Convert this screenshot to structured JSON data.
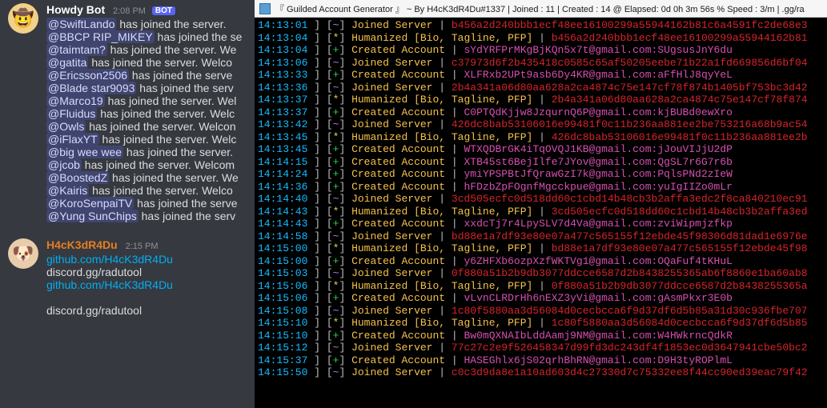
{
  "discord": {
    "bot": {
      "name": "Howdy Bot",
      "time": "2:08 PM",
      "bot_label": "BOT",
      "joins": [
        {
          "user": "SwiftLando",
          "tail": "has joined the server."
        },
        {
          "user": "BBCP RIP_MIKEY",
          "tail": "has joined the se"
        },
        {
          "user": "taimtam?",
          "tail": "has joined the server. We"
        },
        {
          "user": "gatita",
          "tail": "has joined the server. Welco"
        },
        {
          "user": "Ericsson2506",
          "tail": "has joined the serve"
        },
        {
          "user": "Blade star9093",
          "tail": "has joined the serv"
        },
        {
          "user": "Marco19",
          "tail": "has joined the server. Wel"
        },
        {
          "user": "Fluidus",
          "tail": "has joined the server. Welc"
        },
        {
          "user": "Owls",
          "tail": "has joined the server. Welcon"
        },
        {
          "user": "iFlaxYT",
          "tail": "has joined the server. Welc"
        },
        {
          "user": "big wee wee",
          "tail": "has joined the server."
        },
        {
          "user": "jcob",
          "tail": "has joined the server. Welcom"
        },
        {
          "user": "BoostedZ",
          "tail": "has joined the server. We"
        },
        {
          "user": "Kairis",
          "tail": "has joined the server. Welco"
        },
        {
          "user": "KoroSenpaiTV",
          "tail": "has joined the serve"
        },
        {
          "user": "Yung SunChips",
          "tail": "has joined the serv"
        }
      ]
    },
    "hacker": {
      "name": "H4cK3dR4Du",
      "time": "2:15 PM",
      "lines": [
        {
          "text": "github.com/H4cK3dR4Du",
          "link": true
        },
        {
          "text": "discord.gg/radutool",
          "link": false
        },
        {
          "text": "github.com/H4cK3dR4Du",
          "link": true
        },
        {
          "text": "",
          "link": false,
          "spacer": true
        },
        {
          "text": "discord.gg/radutool",
          "link": false
        }
      ]
    }
  },
  "console": {
    "title": "『 Guilded Account Generator 』 ~ By H4cK3dR4Du#1337 | Joined : 11 | Created : 14 @ Elapsed: 0d 0h 3m 56s % Speed : 3/m | .gg/ra",
    "log": [
      {
        "t": "14:13:01",
        "sym": "~",
        "lbl": "Joined Server",
        "val": "b456a2d240bbb1ecf48ee16100299a55944162b81c6a4591fc2de68e3",
        "vc": "red"
      },
      {
        "t": "14:13:04",
        "sym": "*",
        "lbl": "Humanized [Bio, Tagline, PFP]",
        "val": "b456a2d240bbb1ecf48ee16100299a55944162b81",
        "vc": "red"
      },
      {
        "t": "14:13:04",
        "sym": "+",
        "lbl": "Created Account",
        "val": "sYdYRFPrMKgBjKQn5x7t@gmail.com:SUgsusJnY6du",
        "vc": "mag"
      },
      {
        "t": "14:13:06",
        "sym": "~",
        "lbl": "Joined Server",
        "val": "c37973d6f2b435418c0585c65af50205eebe71b22a1fd669856d6bf04",
        "vc": "red"
      },
      {
        "t": "14:13:33",
        "sym": "+",
        "lbl": "Created Account",
        "val": "XLFRxb2UPt9asb6Dy4KR@gmail.com:aFfHlJ8qyYeL",
        "vc": "mag"
      },
      {
        "t": "14:13:36",
        "sym": "~",
        "lbl": "Joined Server",
        "val": "2b4a341a06d80aa628a2ca4874c75e147cf78f874b1405bf753bc3d42",
        "vc": "red"
      },
      {
        "t": "14:13:37",
        "sym": "*",
        "lbl": "Humanized [Bio, Tagline, PFP]",
        "val": "2b4a341a06d80aa628a2ca4874c75e147cf78f874",
        "vc": "red"
      },
      {
        "t": "14:13:37",
        "sym": "+",
        "lbl": "Created Account",
        "val": "C0PTQdKjjw8JzqurnQ6P@gmail.com:kjBUBd0ewXro",
        "vc": "mag"
      },
      {
        "t": "14:13:42",
        "sym": "~",
        "lbl": "Joined Server",
        "val": "426dc8bab53106016e99481f0c11b236aa881ee2be753216a68b9ac54",
        "vc": "red"
      },
      {
        "t": "14:13:45",
        "sym": "*",
        "lbl": "Humanized [Bio, Tagline, PFP]",
        "val": "426dc8bab53106016e99481f0c11b236aa881ee2b",
        "vc": "red"
      },
      {
        "t": "14:13:45",
        "sym": "+",
        "lbl": "Created Account",
        "val": "WTXQDBrGK4iTqOVQJ1KB@gmail.com:jJouVIJjU2dP",
        "vc": "mag"
      },
      {
        "t": "14:14:15",
        "sym": "+",
        "lbl": "Created Account",
        "val": "XTB45st6BejIlfe7JYov@gmail.com:QgSL7r6G7r6b",
        "vc": "mag"
      },
      {
        "t": "14:14:24",
        "sym": "+",
        "lbl": "Created Account",
        "val": "ymiYPSPBtJfQrawGzI7k@gmail.com:PqlsPNd2zIeW",
        "vc": "mag"
      },
      {
        "t": "14:14:36",
        "sym": "+",
        "lbl": "Created Account",
        "val": "hFDzbZpFOgnfMgcckpue@gmail.com:yuIgIIZo0mLr",
        "vc": "mag"
      },
      {
        "t": "14:14:40",
        "sym": "~",
        "lbl": "Joined Server",
        "val": "3cd505ecfc0d518dd60c1cbd14b48cb3b2affa3edc2f8ca840210ec91",
        "vc": "red"
      },
      {
        "t": "14:14:43",
        "sym": "*",
        "lbl": "Humanized [Bio, Tagline, PFP]",
        "val": "3cd505ecfc0d518dd60c1cbd14b48cb3b2affa3ed",
        "vc": "red"
      },
      {
        "t": "14:14:43",
        "sym": "+",
        "lbl": "Created Account",
        "val": "xxdcTj7r4LpySLV7d4Va@gmail.com:zviWipmjzfkp",
        "vc": "mag"
      },
      {
        "t": "14:14:58",
        "sym": "~",
        "lbl": "Joined Server",
        "val": "bd88e1a7df93e80e07a477c565155f12ebde45f98306d81dad1e6976e",
        "vc": "red"
      },
      {
        "t": "14:15:00",
        "sym": "*",
        "lbl": "Humanized [Bio, Tagline, PFP]",
        "val": "bd88e1a7df93e80e07a477c565155f12ebde45f98",
        "vc": "red"
      },
      {
        "t": "14:15:00",
        "sym": "+",
        "lbl": "Created Account",
        "val": "y6ZHFXb6ozpXzfWKTVg1@gmail.com:OQaFuf4tKHuL",
        "vc": "mag"
      },
      {
        "t": "14:15:03",
        "sym": "~",
        "lbl": "Joined Server",
        "val": "0f880a51b2b9db3077ddcce6587d2b8438255365ab6f8860e1ba60ab8",
        "vc": "red"
      },
      {
        "t": "14:15:06",
        "sym": "*",
        "lbl": "Humanized [Bio, Tagline, PFP]",
        "val": "0f880a51b2b9db3077ddcce6587d2b8438255365a",
        "vc": "red"
      },
      {
        "t": "14:15:06",
        "sym": "+",
        "lbl": "Created Account",
        "val": "vLvnCLRDrHh6nEXZ3yVi@gmail.com:gAsmPkxr3E0b",
        "vc": "mag"
      },
      {
        "t": "14:15:08",
        "sym": "~",
        "lbl": "Joined Server",
        "val": "1c80f5880aa3d56084d0cecbcca6f9d37df6d5b85a31d30c936fbe707",
        "vc": "red"
      },
      {
        "t": "14:15:10",
        "sym": "*",
        "lbl": "Humanized [Bio, Tagline, PFP]",
        "val": "1c80f5880aa3d56084d0cecbcca6f9d37df6d5b85",
        "vc": "red"
      },
      {
        "t": "14:15:10",
        "sym": "+",
        "lbl": "Created Account",
        "val": "Bw0mQXNAIbLddAamj9NM@gmail.com:W4HWkrncQdkR",
        "vc": "mag"
      },
      {
        "t": "14:15:12",
        "sym": "~",
        "lbl": "Joined Server",
        "val": "77c27c2e9f526458347d99fd3dc243df4f1853ec0d3647941cbe50bc2",
        "vc": "red"
      },
      {
        "t": "14:15:37",
        "sym": "+",
        "lbl": "Created Account",
        "val": "HASEGhlx6jS02qrhBhRN@gmail.com:D9H3tyROPlmL",
        "vc": "mag"
      },
      {
        "t": "14:15:50",
        "sym": "~",
        "lbl": "Joined Server",
        "val": "c0c3d9da8e1a10ad603d4c27330d7c75332ee8f44cc90ed39eac79f42",
        "vc": "red"
      }
    ]
  }
}
